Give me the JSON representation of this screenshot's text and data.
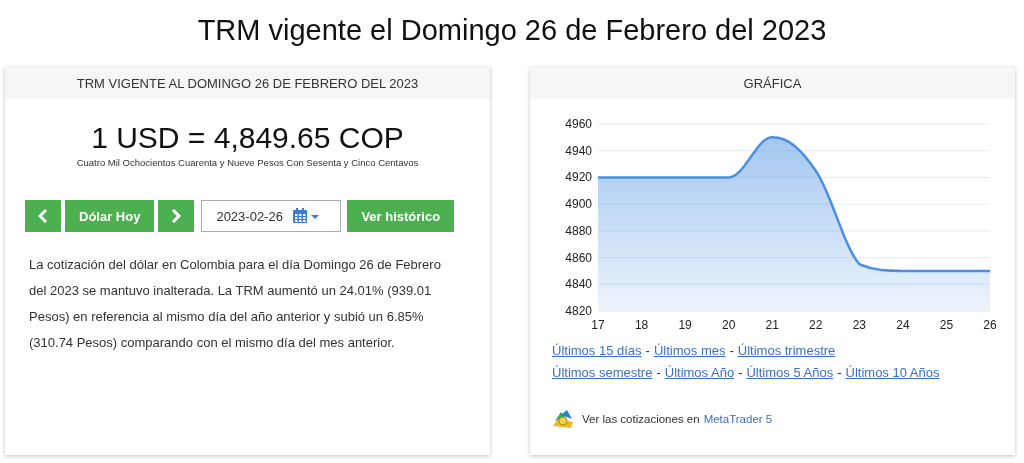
{
  "page_title": "TRM vigente el Domingo 26 de Febrero del 2023",
  "rate_card": {
    "header": "TRM VIGENTE AL DOMINGO 26 DE FEBRERO DEL 2023",
    "rate": "1 USD = 4,849.65 COP",
    "rate_words": "Cuatro Mil Ochocientos Cuarenta y Nueve Pesos Con Sesenta y Cinco Centavos",
    "controls": [
      {
        "kind": "prev"
      },
      {
        "kind": "button",
        "label": "Dólar Hoy"
      },
      {
        "kind": "next"
      },
      {
        "kind": "date",
        "value": "2023-02-26"
      },
      {
        "kind": "button",
        "label": "Ver histórico"
      }
    ],
    "description": "La cotización del dólar en Colombia para el día Domingo 26 de Febrero del 2023 se mantuvo inalterada. La TRM aumentó un 24.01% (939.01 Pesos) en referencia al mismo día del año anterior y subió un 6.85% (310.74 Pesos) comparando con el mismo día del mes anterior."
  },
  "chart_card": {
    "header": "GRÁFICA",
    "chart_data": {
      "type": "area",
      "categories": [
        "17",
        "18",
        "19",
        "20",
        "21",
        "22",
        "23",
        "24",
        "25",
        "26"
      ],
      "grid": true,
      "series": [
        {
          "color": "#4a90e2",
          "values": [
            4920,
            4920,
            4920,
            4920,
            4950,
            4925,
            4855,
            4850,
            4850,
            4850
          ]
        }
      ],
      "ylim": [
        4820,
        4960
      ],
      "yticks": [
        4820,
        4840,
        4860,
        4880,
        4900,
        4920,
        4940,
        4960
      ]
    },
    "link_rows": [
      [
        {
          "label": "Últimos 15 días",
          "separator": "-"
        },
        {
          "label": "Últimos mes",
          "separator": "-"
        },
        {
          "label": "Últimos trimestre"
        }
      ],
      [
        {
          "label": "Últimos semestre",
          "separator": "-"
        },
        {
          "label": "Últimos Año",
          "separator": "-"
        },
        {
          "label": "Últimos 5 Años",
          "separator": "-"
        },
        {
          "label": "Últimos 10 Años"
        }
      ]
    ],
    "footer": {
      "text": "Ver las cotizaciones en",
      "link": "MetaTrader 5"
    }
  }
}
